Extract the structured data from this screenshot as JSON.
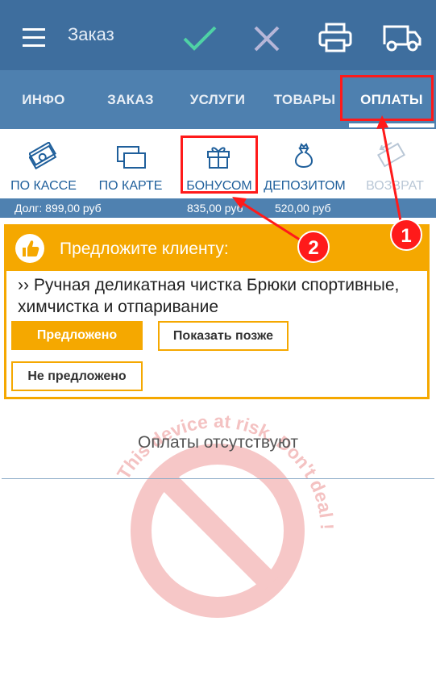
{
  "header": {
    "title": "Заказ",
    "icons": [
      "menu-icon",
      "check-icon",
      "close-icon",
      "printer-icon",
      "delivery-truck-icon"
    ]
  },
  "tabs": [
    {
      "label": "ИНФО"
    },
    {
      "label": "ЗАКАЗ"
    },
    {
      "label": "УСЛУГИ"
    },
    {
      "label": "ТОВАРЫ"
    },
    {
      "label": "ОПЛАТЫ",
      "active": true
    }
  ],
  "payment_methods": [
    {
      "label": "ПО КАССЕ",
      "icon": "cash-icon"
    },
    {
      "label": "ПО КАРТЕ",
      "icon": "cards-icon"
    },
    {
      "label": "БОНУСОМ",
      "icon": "gift-icon"
    },
    {
      "label": "ДЕПОЗИТОМ",
      "icon": "money-bag-icon"
    },
    {
      "label": "ВОЗВРАТ",
      "icon": "refund-icon",
      "disabled": true
    }
  ],
  "debt_bar": {
    "debt": "Долг: 899,00 руб",
    "bonus": "835,00 руб",
    "deposit": "520,00 руб"
  },
  "offer": {
    "header": "Предложите клиенту:",
    "service": "›› Ручная деликатная чистка Брюки спортивные, химчистка и отпаривание",
    "btn_offered": "Предложено",
    "btn_later": "Показать позже",
    "btn_not_offered": "Не предложено"
  },
  "payments_empty": "Оплаты отсутствуют",
  "watermark": "This device at risk. Don't deal !",
  "annotations": {
    "badge1": "1",
    "badge2": "2",
    "color": "#ff1a1a"
  },
  "colors": {
    "header": "#3e6e9e",
    "tabs": "#4e80af",
    "accent": "#f5a800",
    "check": "#4fd2a5",
    "close": "#b6b6d8"
  }
}
